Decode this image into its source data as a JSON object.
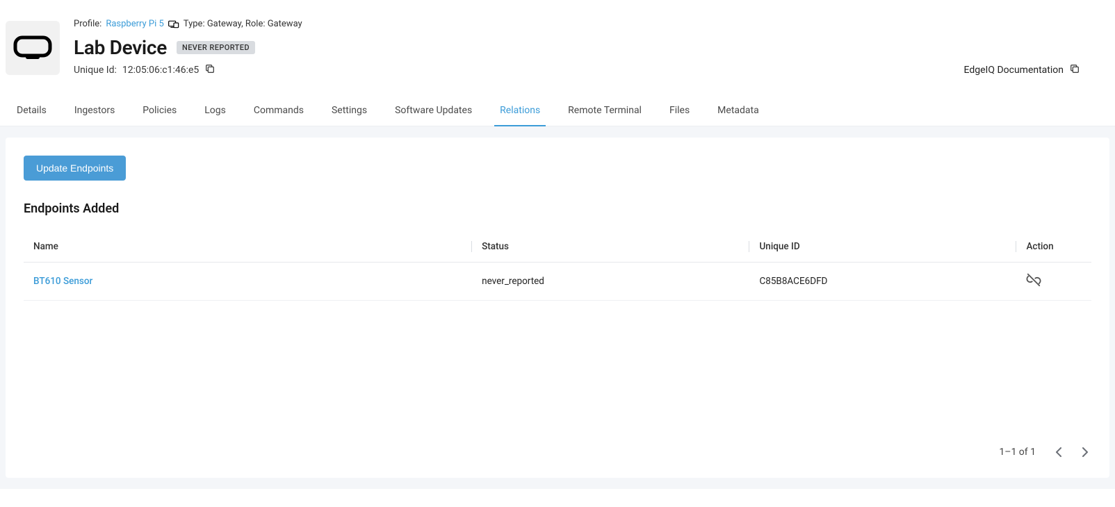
{
  "header": {
    "profile_label": "Profile:",
    "profile_link": "Raspberry Pi 5",
    "type_role": "Type: Gateway, Role: Gateway",
    "title": "Lab Device",
    "status_badge": "NEVER REPORTED",
    "uid_label": "Unique Id:",
    "uid_value": "12:05:06:c1:46:e5",
    "doc_link": "EdgeIQ Documentation"
  },
  "tabs": [
    "Details",
    "Ingestors",
    "Policies",
    "Logs",
    "Commands",
    "Settings",
    "Software Updates",
    "Relations",
    "Remote Terminal",
    "Files",
    "Metadata"
  ],
  "active_tab": "Relations",
  "panel": {
    "update_button": "Update Endpoints",
    "section_title": "Endpoints Added",
    "columns": {
      "name": "Name",
      "status": "Status",
      "uid": "Unique ID",
      "action": "Action"
    },
    "rows": [
      {
        "name": "BT610 Sensor",
        "status": "never_reported",
        "uid": "C85B8ACE6DFD"
      }
    ],
    "pagination": "1–1 of 1"
  },
  "colors": {
    "accent": "#3c9cd8"
  }
}
